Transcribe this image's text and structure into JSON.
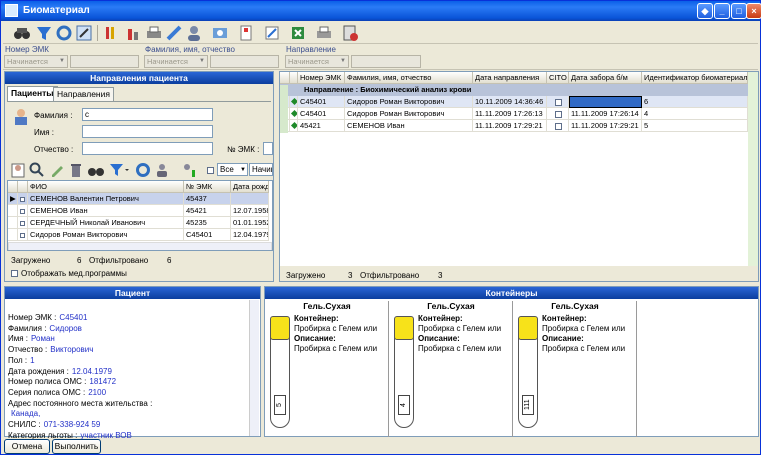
{
  "window": {
    "title": "Биоматериал",
    "colors": {
      "titlebar": "#0a5fe8",
      "panel_header": "#1d52c4",
      "selected_row": "#c7d2ec",
      "group_row": "#b8c3d9"
    }
  },
  "toolbar": {
    "icons": [
      "binoculars-icon",
      "filter-icon",
      "refresh-icon",
      "edit-icon",
      "bars-icon",
      "chart-icon",
      "printer-icon",
      "syringe-icon",
      "user-icon",
      "preview-icon",
      "add-doc-icon",
      "edit-doc-icon",
      "export-icon",
      "print-icon",
      "exit-icon"
    ]
  },
  "filters": {
    "emk_label": "Номер ЭМК",
    "fio_label": "Фамилия, имя, отчество",
    "dir_label": "Направление",
    "mode_text": "Начинается"
  },
  "left": {
    "header": "Направления пациента",
    "tab_patients": "Пациенты",
    "tab_directions": "Направления",
    "surname_label": "Фамилия :",
    "surname_value": "с",
    "name_label": "Имя :",
    "patronymic_label": "Отчество :",
    "emk_label": "№ ЭМК :",
    "all_option": "Все",
    "starts_option": "Начина",
    "columns": [
      "ФИО",
      "№ ЭМК",
      "Дата рожд"
    ],
    "rows": [
      [
        "СЕМЕНОВ Валентин Петрович",
        "45437",
        ""
      ],
      [
        "СЕМЕНОВ Иван",
        "45421",
        "12.07.1958"
      ],
      [
        "СЕРДЕЧНЫЙ Николай Иванович",
        "45235",
        "01.01.1952"
      ],
      [
        "Сидоров Роман Викторович",
        "С45401",
        "12.04.1979"
      ]
    ],
    "loaded_label": "Загружено",
    "loaded_value": "6",
    "filtered_label": "Отфильтровано",
    "filtered_value": "6",
    "show_programs": "Отображать мед.программы"
  },
  "right": {
    "columns": [
      "Номер ЭМК",
      "Фамилия, имя, отчество",
      "Дата направления",
      "CITO",
      "Дата забора б/м",
      "Идентификатор биоматериала"
    ],
    "group": "Направление : Биохимический анализ крови",
    "rows": [
      [
        "С45401",
        "Сидоров Роман Викторович",
        "10.11.2009 14:36:46",
        "",
        "6"
      ],
      [
        "С45401",
        "Сидоров Роман Викторович",
        "11.11.2009 17:26:13",
        "11.11.2009 17:26:14",
        "4"
      ],
      [
        "45421",
        "СЕМЕНОВ Иван",
        "11.11.2009 17:29:21",
        "11.11.2009 17:29:21",
        "5"
      ]
    ],
    "loaded_label": "Загружено",
    "loaded_value": "3",
    "filtered_label": "Отфильтровано",
    "filtered_value": "3"
  },
  "patient": {
    "header": "Пациент",
    "fields": [
      [
        "Номер ЭМК :",
        "С45401"
      ],
      [
        "Фамилия :",
        "Сидоров"
      ],
      [
        "Имя :",
        "Роман"
      ],
      [
        "Отчество :",
        "Викторович"
      ],
      [
        "Пол :",
        "1"
      ],
      [
        "Дата рождения :",
        "12.04.1979"
      ],
      [
        "Номер полиса ОМС :",
        "181472"
      ],
      [
        "Серия полиса ОМС :",
        "2100"
      ],
      [
        "Адрес постоянного места жительства :",
        ""
      ],
      [
        "",
        "Канада,"
      ],
      [
        "СНИЛС :",
        "071-338-924 59"
      ],
      [
        "Категория льготы :",
        "участник ВОВ"
      ]
    ]
  },
  "containers": {
    "header": "Контейнеры",
    "container_label": "Контейнер:",
    "description_label": "Описание:",
    "items": [
      {
        "title": "Гель.Сухая",
        "desc": "Пробирка с Гелем или",
        "num": "5"
      },
      {
        "title": "Гель.Сухая",
        "desc": "Пробирка с Гелем или",
        "num": "4"
      },
      {
        "title": "Гель.Сухая",
        "desc": "Пробирка с Гелем или",
        "num": "111"
      }
    ]
  },
  "buttons": {
    "cancel": "Отмена",
    "execute": "Выполнить"
  }
}
